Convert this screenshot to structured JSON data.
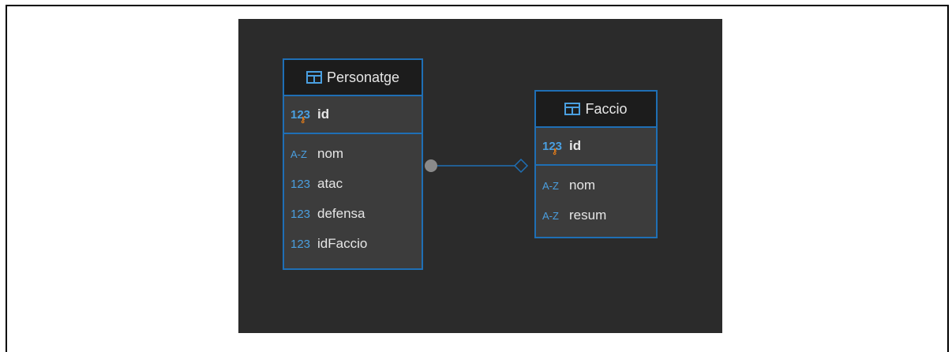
{
  "diagram": {
    "entities": [
      {
        "name": "Personatge",
        "key": {
          "type": "123",
          "name": "id"
        },
        "fields": [
          {
            "type": "A-Z",
            "name": "nom"
          },
          {
            "type": "123",
            "name": "atac"
          },
          {
            "type": "123",
            "name": "defensa"
          },
          {
            "type": "123",
            "name": "idFaccio"
          }
        ]
      },
      {
        "name": "Faccio",
        "key": {
          "type": "123",
          "name": "id"
        },
        "fields": [
          {
            "type": "A-Z",
            "name": "nom"
          },
          {
            "type": "A-Z",
            "name": "resum"
          }
        ]
      }
    ],
    "relationship": {
      "from": "Personatge",
      "to": "Faccio"
    },
    "colors": {
      "background": "#2b2b2b",
      "border": "#1f6fb5",
      "type_icon": "#4a9fe0",
      "key_marker": "#e07b1a"
    }
  }
}
